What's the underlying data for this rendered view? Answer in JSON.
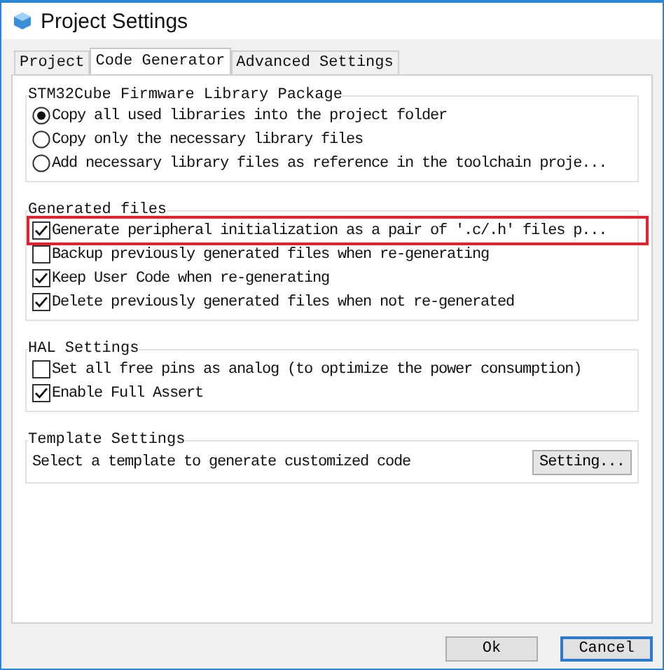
{
  "window": {
    "title": "Project Settings"
  },
  "tabs": [
    {
      "label": "Project",
      "selected": false
    },
    {
      "label": "Code Generator",
      "selected": true
    },
    {
      "label": "Advanced Settings",
      "selected": false
    }
  ],
  "groups": [
    {
      "title": "STM32Cube Firmware Library Package",
      "options": [
        {
          "kind": "radio",
          "label": "Copy all used libraries into the project folder",
          "selected": true,
          "highlighted": false
        },
        {
          "kind": "radio",
          "label": "Copy only the necessary library files",
          "selected": false,
          "highlighted": false
        },
        {
          "kind": "radio",
          "label": "Add necessary library files as reference in the toolchain proje...",
          "selected": false,
          "highlighted": false
        }
      ]
    },
    {
      "title": "Generated files",
      "options": [
        {
          "kind": "checkbox",
          "label": "Generate peripheral initialization as a pair of '.c/.h' files p...",
          "checked": true,
          "highlighted": true
        },
        {
          "kind": "checkbox",
          "label": "Backup previously generated files when re-generating",
          "checked": false,
          "highlighted": false
        },
        {
          "kind": "checkbox",
          "label": "Keep User Code when re-generating",
          "checked": true,
          "highlighted": false
        },
        {
          "kind": "checkbox",
          "label": "Delete previously generated files when not re-generated",
          "checked": true,
          "highlighted": false
        }
      ]
    },
    {
      "title": "HAL Settings",
      "options": [
        {
          "kind": "checkbox",
          "label": "Set all free pins as analog (to optimize the power consumption)",
          "checked": false,
          "highlighted": false
        },
        {
          "kind": "checkbox",
          "label": "Enable Full Assert",
          "checked": true,
          "highlighted": false
        }
      ]
    },
    {
      "title": "Template Settings",
      "options": [
        {
          "kind": "text_button",
          "label": "Select a template to generate customized code",
          "button": "Setting...",
          "highlighted": false
        }
      ]
    }
  ],
  "buttons": [
    {
      "label": "Ok",
      "focused": false
    },
    {
      "label": "Cancel",
      "focused": true
    }
  ]
}
